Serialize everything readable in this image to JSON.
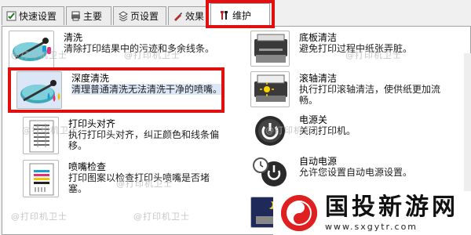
{
  "tabs": [
    {
      "label": "快速设置",
      "icon": "check-icon"
    },
    {
      "label": "主要",
      "icon": "printer-icon"
    },
    {
      "label": "页设置",
      "icon": "pages-icon"
    },
    {
      "label": "效果",
      "icon": "brush-icon"
    },
    {
      "label": "维护",
      "icon": "tools-icon",
      "active": true
    }
  ],
  "left_items": [
    {
      "title": "清洗",
      "desc": "清除打印结果中的污迹和多余线条。",
      "icon": "cleaning-icon"
    },
    {
      "title": "深度清洗",
      "desc": "清理普通清洗无法清洗干净的喷嘴。",
      "icon": "deep-cleaning-icon",
      "selected": true
    },
    {
      "title": "打印头对齐",
      "desc": "执行打印头对齐，纠正颜色和线条偏\n移。",
      "icon": "print-head-alignment-icon"
    },
    {
      "title": "喷嘴检查",
      "desc": "打印图案以检查打印头喷嘴是否堵\n塞。",
      "icon": "nozzle-check-icon"
    }
  ],
  "right_items": [
    {
      "title": "底板清洁",
      "desc": "避免打印过程中纸张弄脏。",
      "icon": "bottom-plate-cleaning-icon"
    },
    {
      "title": "滚轴清洁",
      "desc": "执行打印滚轴清洁，使供纸更加流\n畅。",
      "icon": "roller-cleaning-icon"
    },
    {
      "title": "电源关",
      "desc": "关闭打印机。",
      "icon": "power-off-icon"
    },
    {
      "title": "自动电源",
      "desc": "允许您设置自动电源设置。",
      "icon": "auto-power-icon"
    },
    {
      "title": "",
      "desc": "",
      "icon": "quiet-mode-icon"
    }
  ],
  "watermark": "@打印机卫士",
  "brand": {
    "name": "国投新游网",
    "url": "www.sxgytr.com"
  },
  "colors": {
    "highlight": "#e01010",
    "selected_bg": "#dbe7f6",
    "brand_red": "#e02020"
  }
}
